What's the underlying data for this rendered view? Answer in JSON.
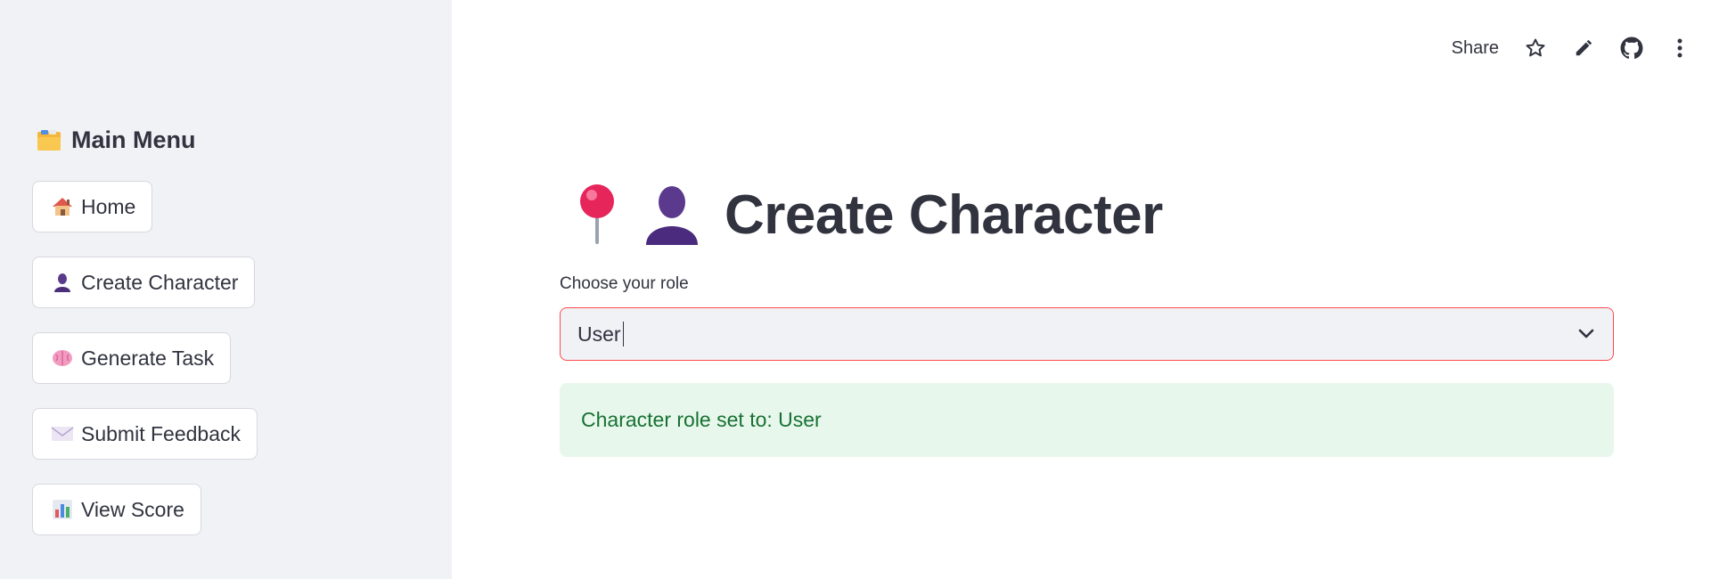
{
  "sidebar": {
    "title_icon": "card-index-dividers-icon",
    "title": "Main Menu",
    "items": [
      {
        "icon": "house-icon",
        "label": "Home"
      },
      {
        "icon": "bust-silhouette-icon",
        "label": "Create Character"
      },
      {
        "icon": "brain-icon",
        "label": "Generate Task"
      },
      {
        "icon": "envelope-icon",
        "label": "Submit Feedback"
      },
      {
        "icon": "bar-chart-icon",
        "label": "View Score"
      }
    ]
  },
  "toolbar": {
    "share_label": "Share",
    "icons": [
      "star-icon",
      "pencil-icon",
      "github-icon",
      "more-vertical-icon"
    ]
  },
  "main": {
    "title": "Create Character",
    "title_icons": [
      "round-pushpin-icon",
      "bust-silhouette-icon"
    ],
    "select": {
      "label": "Choose your role",
      "value": "User"
    },
    "success_message": "Character role set to: User"
  },
  "colors": {
    "sidebar_bg": "#f0f2f6",
    "accent": "#ff4b4b",
    "success_bg": "#e8f7ec",
    "success_text": "#177233",
    "text": "#31333f"
  }
}
